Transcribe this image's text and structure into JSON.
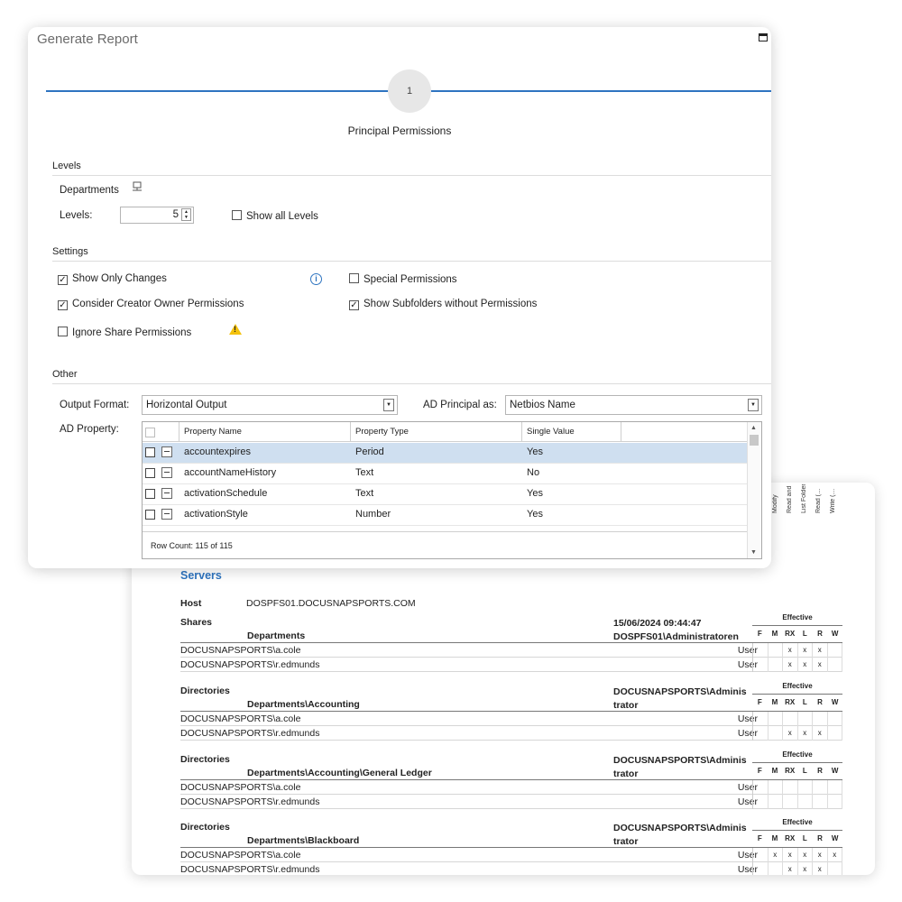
{
  "report": {
    "rotated_headers": [
      "Modify",
      "Read and Execute",
      "List Folder Contents",
      "Read (…",
      "Write (…"
    ],
    "servers_title": "Servers",
    "host_label": "Host",
    "host_value": "DOSPFS01.DOCUSNAPSPORTS.COM",
    "effective_label": "Effective",
    "perm_cols": [
      "F",
      "M",
      "RX",
      "L",
      "R",
      "W"
    ],
    "sections": [
      {
        "type": "Shares",
        "path": "Departments",
        "meta": [
          "15/06/2024 09:44:47",
          "DOSPFS01\\Administratoren"
        ],
        "rows": [
          {
            "account": "DOCUSNAPSPORTS\\a.cole",
            "kind": "User",
            "cells": [
              "",
              "",
              "x",
              "x",
              "x",
              ""
            ]
          },
          {
            "account": "DOCUSNAPSPORTS\\r.edmunds",
            "kind": "User",
            "cells": [
              "",
              "",
              "x",
              "x",
              "x",
              ""
            ]
          }
        ]
      },
      {
        "type": "Directories",
        "path": "Departments\\Accounting",
        "meta": [
          "DOCUSNAPSPORTS\\Adminis",
          "trator"
        ],
        "rows": [
          {
            "account": "DOCUSNAPSPORTS\\a.cole",
            "kind": "User",
            "cells": [
              "",
              "",
              "",
              "",
              "",
              ""
            ]
          },
          {
            "account": "DOCUSNAPSPORTS\\r.edmunds",
            "kind": "User",
            "cells": [
              "",
              "",
              "x",
              "x",
              "x",
              ""
            ]
          }
        ]
      },
      {
        "type": "Directories",
        "path": "Departments\\Accounting\\General Ledger",
        "meta": [
          "DOCUSNAPSPORTS\\Adminis",
          "trator"
        ],
        "rows": [
          {
            "account": "DOCUSNAPSPORTS\\a.cole",
            "kind": "User",
            "cells": [
              "",
              "",
              "",
              "",
              "",
              ""
            ]
          },
          {
            "account": "DOCUSNAPSPORTS\\r.edmunds",
            "kind": "User",
            "cells": [
              "",
              "",
              "",
              "",
              "",
              ""
            ]
          }
        ]
      },
      {
        "type": "Directories",
        "path": "Departments\\Blackboard",
        "meta": [
          "DOCUSNAPSPORTS\\Adminis",
          "trator"
        ],
        "rows": [
          {
            "account": "DOCUSNAPSPORTS\\a.cole",
            "kind": "User",
            "cells": [
              "",
              "x",
              "x",
              "x",
              "x",
              "x"
            ]
          },
          {
            "account": "DOCUSNAPSPORTS\\r.edmunds",
            "kind": "User",
            "cells": [
              "",
              "",
              "x",
              "x",
              "x",
              ""
            ]
          }
        ]
      }
    ]
  },
  "dialog": {
    "title": "Generate Report",
    "step_number": "1",
    "step_label": "Principal Permissions",
    "levels_group": "Levels",
    "departments_label": "Departments",
    "levels_label": "Levels:",
    "levels_value": "5",
    "show_all_levels": "Show all Levels",
    "settings_group": "Settings",
    "show_only_changes": "Show Only Changes",
    "consider_creator_owner": "Consider Creator Owner Permissions",
    "ignore_share": "Ignore Share Permissions",
    "special_permissions": "Special Permissions",
    "show_subfolders": "Show Subfolders without Permissions",
    "other_group": "Other",
    "output_format_label": "Output Format:",
    "output_format_value": "Horizontal Output",
    "ad_principal_label": "AD Principal as:",
    "ad_principal_value": "Netbios Name",
    "ad_property_label": "AD Property:",
    "grid": {
      "headers": [
        "Property Name",
        "Property Type",
        "Single Value"
      ],
      "rows": [
        {
          "name": "accountexpires",
          "type": "Period",
          "single": "Yes"
        },
        {
          "name": "accountNameHistory",
          "type": "Text",
          "single": "No"
        },
        {
          "name": "activationSchedule",
          "type": "Text",
          "single": "Yes"
        },
        {
          "name": "activationStyle",
          "type": "Number",
          "single": "Yes"
        }
      ],
      "row_count": "Row Count: 115 of 115"
    },
    "colors": {
      "accent": "#2e74c0",
      "selected_row": "#cfdff0",
      "warning": "#f4c20d"
    }
  }
}
